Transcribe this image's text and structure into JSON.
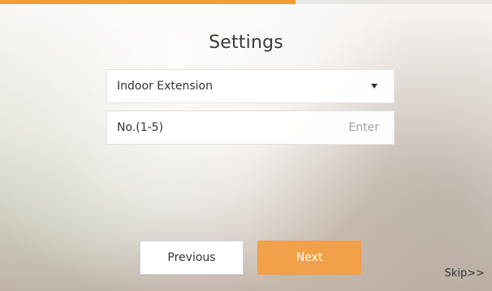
{
  "progress": {
    "fraction": 0.6,
    "color": "#f29d34"
  },
  "page": {
    "title": "Settings"
  },
  "settings": {
    "role_select": {
      "selected": "Indoor Extension",
      "icon": "chevron-down-icon"
    },
    "number_field": {
      "label": "No.(1-5)",
      "placeholder": "Enter",
      "value": ""
    }
  },
  "actions": {
    "previous_label": "Previous",
    "next_label": "Next",
    "skip_label": "Skip>>"
  },
  "colors": {
    "accent": "#f2a04a",
    "button_light": "#ffffff",
    "text_dark": "#333333",
    "placeholder": "#9e9e9e"
  }
}
